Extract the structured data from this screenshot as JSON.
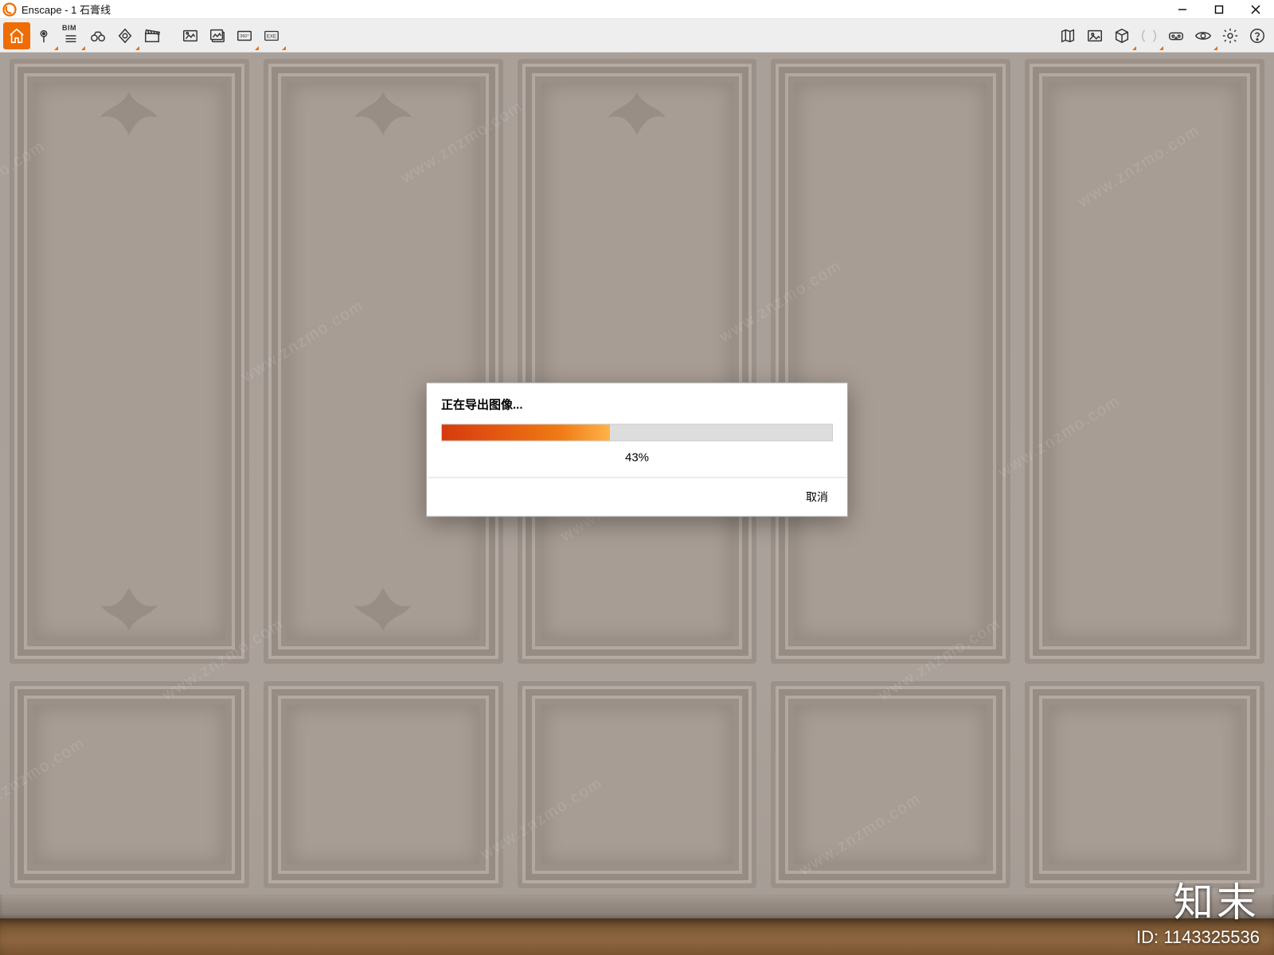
{
  "window": {
    "title": "Enscape - 1   石膏线"
  },
  "toolbar": {
    "left_icons": [
      {
        "name": "home-icon",
        "active": true,
        "dd": false
      },
      {
        "name": "pin-icon",
        "dd": true
      },
      {
        "name": "bim-mode-icon",
        "dd": true,
        "label": "BIM"
      },
      {
        "name": "binoculars-icon",
        "dd": false
      },
      {
        "name": "safe-frame-icon",
        "dd": true
      },
      {
        "name": "clapperboard-icon",
        "dd": false
      }
    ],
    "mid_icons": [
      {
        "name": "screenshot-icon",
        "dd": false
      },
      {
        "name": "batch-render-icon",
        "dd": false
      },
      {
        "name": "panorama-icon",
        "dd": true
      },
      {
        "name": "exe-export-icon",
        "dd": true
      }
    ],
    "right_icons": [
      {
        "name": "map-icon",
        "dd": false
      },
      {
        "name": "asset-library-icon",
        "dd": false
      },
      {
        "name": "cube-icon",
        "dd": true,
        "disabled": false
      },
      {
        "name": "section-icon",
        "dd": true,
        "disabled": true
      },
      {
        "name": "vr-icon",
        "dd": false
      },
      {
        "name": "eye-icon",
        "dd": true
      },
      {
        "name": "settings-icon",
        "dd": false
      },
      {
        "name": "help-icon",
        "dd": false
      }
    ]
  },
  "dialog": {
    "title": "正在导出图像...",
    "progress_percent": 43,
    "percent_label": "43%",
    "cancel_label": "取消"
  },
  "watermark": {
    "text": "www.znzmo.com",
    "brand_text": "知末",
    "id_label": "ID: 1143325536"
  },
  "colors": {
    "accent": "#EF6C00",
    "progress_start": "#D63A0E",
    "progress_end": "#FFB24A"
  }
}
